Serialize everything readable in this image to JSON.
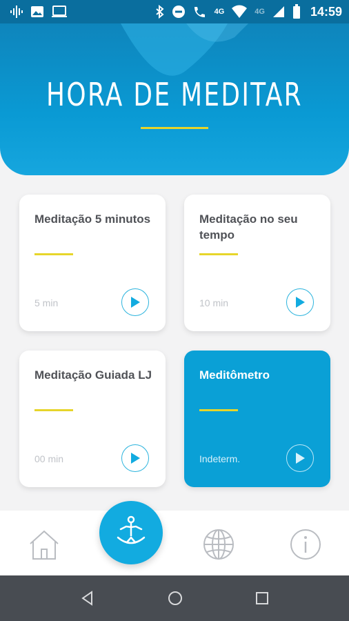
{
  "status_bar": {
    "time": "14:59",
    "network_1": "4G",
    "network_2": "4G",
    "icons": [
      "signal-app-icon",
      "image-icon",
      "laptop-icon",
      "bluetooth-icon",
      "do-not-disturb-icon",
      "wifi-call-icon",
      "wifi-icon",
      "cell-signal-icon",
      "battery-icon"
    ]
  },
  "header": {
    "title": "HORA DE MEDITAR",
    "accent_color": "#e7d52a"
  },
  "cards": [
    {
      "title": "Meditação 5 minutos",
      "duration": "5 min",
      "style": "white"
    },
    {
      "title": "Meditação no seu tempo",
      "duration": "10 min",
      "style": "white"
    },
    {
      "title": "Meditação Guiada LJ",
      "duration": "00 min",
      "style": "white"
    },
    {
      "title": "Meditômetro",
      "duration": "Indeterm.",
      "style": "blue"
    }
  ],
  "bottom_nav": {
    "items": [
      "home-icon",
      "meditation-icon",
      "globe-icon",
      "info-icon"
    ],
    "active": "meditation-icon"
  },
  "colors": {
    "primary": "#0aa0d6",
    "status_bar": "#0a6e9e",
    "android_nav": "#484c52"
  }
}
